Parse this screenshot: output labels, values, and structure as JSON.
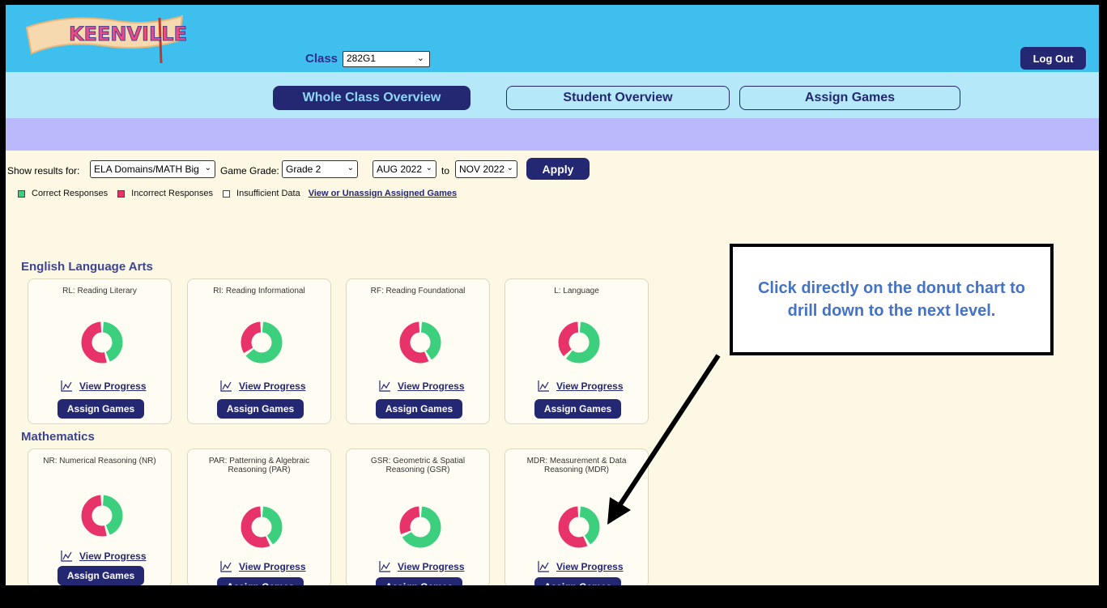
{
  "app": {
    "logo_text": "KEENVILLE"
  },
  "header": {
    "class_label": "Class",
    "class_value": "282G1",
    "logout_label": "Log Out"
  },
  "nav": {
    "tabs": [
      {
        "label": "Whole Class Overview",
        "active": true
      },
      {
        "label": "Student Overview",
        "active": false
      },
      {
        "label": "Assign Games",
        "active": false
      }
    ]
  },
  "filters": {
    "show_results_label": "Show results for:",
    "show_results_value": "ELA Domains/MATH Big",
    "game_grade_label": "Game Grade:",
    "game_grade_value": "Grade 2",
    "from_value": "AUG 2022",
    "to_label": "to",
    "to_value": "NOV 2022",
    "apply_label": "Apply"
  },
  "legend": {
    "correct": "Correct Responses",
    "incorrect": "Incorrect Responses",
    "insufficient": "Insufficient Data",
    "link": "View or Unassign Assigned Games",
    "colors": {
      "correct": "#3ccf7e",
      "incorrect": "#e8336a"
    }
  },
  "sections": [
    {
      "title": "English Language Arts",
      "cards": [
        {
          "title": "RL: Reading Literary",
          "correct_fraction": 0.45,
          "view_progress": "View Progress",
          "assign": "Assign Games"
        },
        {
          "title": "RI: Reading Informational",
          "correct_fraction": 0.65,
          "view_progress": "View Progress",
          "assign": "Assign Games"
        },
        {
          "title": "RF: Reading Foundational",
          "correct_fraction": 0.42,
          "view_progress": "View Progress",
          "assign": "Assign Games"
        },
        {
          "title": "L: Language",
          "correct_fraction": 0.62,
          "view_progress": "View Progress",
          "assign": "Assign Games"
        }
      ]
    },
    {
      "title": "Mathematics",
      "cards": [
        {
          "title": "NR: Numerical Reasoning (NR)",
          "correct_fraction": 0.45,
          "view_progress": "View Progress",
          "assign": "Assign Games"
        },
        {
          "title": "PAR: Patterning & Algebraic Reasoning (PAR)",
          "correct_fraction": 0.42,
          "view_progress": "View Progress",
          "assign": "Assign Games"
        },
        {
          "title": "GSR: Geometric & Spatial Reasoning (GSR)",
          "correct_fraction": 0.68,
          "view_progress": "View Progress",
          "assign": "Assign Games"
        },
        {
          "title": "MDR: Measurement & Data Reasoning (MDR)",
          "correct_fraction": 0.42,
          "view_progress": "View Progress",
          "assign": "Assign Games"
        }
      ]
    }
  ],
  "callout": {
    "text": "Click directly on the donut chart to drill down to the next level."
  }
}
